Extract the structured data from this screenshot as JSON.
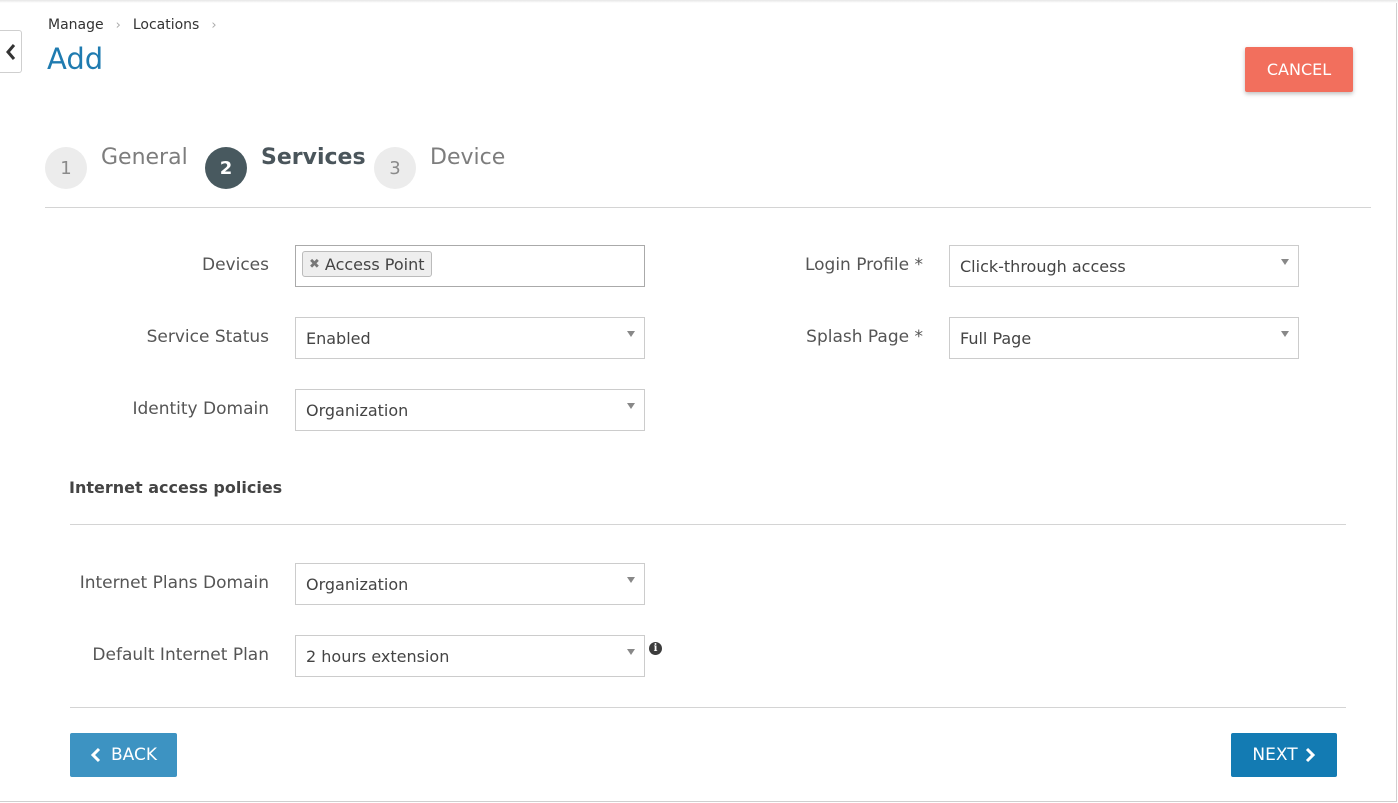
{
  "breadcrumb": [
    "Manage",
    "Locations"
  ],
  "page_title": "Add",
  "cancel_label": "CANCEL",
  "steps": [
    {
      "number": "1",
      "label": "General",
      "active": false
    },
    {
      "number": "2",
      "label": "Services",
      "active": true
    },
    {
      "number": "3",
      "label": "Device",
      "active": false
    }
  ],
  "form": {
    "devices": {
      "label": "Devices",
      "tags": [
        "Access Point"
      ]
    },
    "service_status": {
      "label": "Service Status",
      "value": "Enabled"
    },
    "identity_domain": {
      "label": "Identity Domain",
      "value": "Organization"
    },
    "login_profile": {
      "label": "Login Profile *",
      "value": "Click-through access"
    },
    "splash_page": {
      "label": "Splash Page *",
      "value": "Full Page"
    }
  },
  "internet_section": {
    "title": "Internet access policies",
    "plans_domain": {
      "label": "Internet Plans Domain",
      "value": "Organization"
    },
    "default_plan": {
      "label": "Default Internet Plan",
      "value": "2 hours extension"
    },
    "info_glyph": "i"
  },
  "nav": {
    "back_label": "BACK",
    "next_label": "NEXT"
  },
  "colors": {
    "accent": "#1f7bb0",
    "cancel": "#f26f5d",
    "back": "#3d93c2",
    "next": "#137bb3",
    "active_step": "#48595f"
  },
  "icons": [
    "collapse-chevron-left-icon",
    "breadcrumb-chevron-icon",
    "tag-remove-icon",
    "dropdown-caret-icon",
    "info-icon",
    "chevron-left-icon",
    "chevron-right-icon"
  ]
}
